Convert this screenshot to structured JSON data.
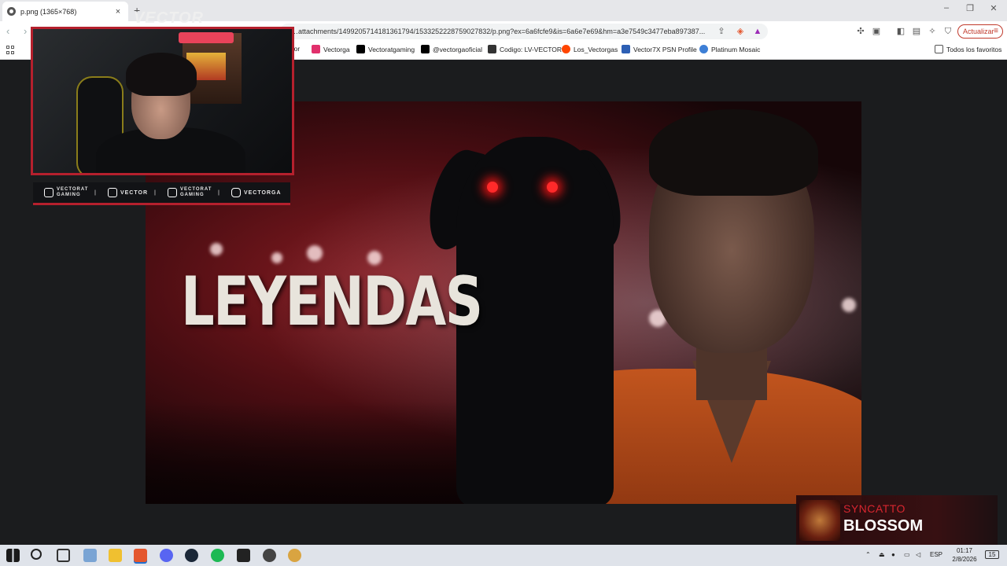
{
  "browser": {
    "tab_title": "p.png (1365×768)",
    "tab_close": "×",
    "new_tab": "+",
    "url": "…attachments/1499205714181361794/1533252228759027832/p.png?ex=6a6fcfe9&is=6a6e7e69&hm=a3e7549c3477eba897387...",
    "update_label": "Actualizar",
    "window_controls": [
      "–",
      "❐",
      "✕"
    ]
  },
  "bookmarks": {
    "items": [
      {
        "label": "ctor",
        "color": "#888888"
      },
      {
        "label": "Vectorga",
        "color": "#e1306c"
      },
      {
        "label": "Vectoratgaming",
        "color": "#000000"
      },
      {
        "label": "@vectorgaoficial",
        "color": "#000000"
      },
      {
        "label": "Codigo: LV-VECTOR",
        "color": "#333333"
      },
      {
        "label": "Los_Vectorgas",
        "color": "#ff4500"
      },
      {
        "label": "Vector7X PSN Profile",
        "color": "#2d5fb4"
      },
      {
        "label": "Platinum Mosaic",
        "color": "#3d7fd6"
      }
    ],
    "all_favorites": "Todos los favoritos"
  },
  "thumbnail": {
    "title": "LEYENDAS"
  },
  "webcam": {
    "logo": "VECTOR",
    "socials": [
      {
        "label": "VECTORAT GAMING",
        "icon": "youtube-icon"
      },
      {
        "label": "VECTOR",
        "icon": "twitch-icon"
      },
      {
        "label": "VECTORAT GAMING",
        "icon": "twitter-icon"
      },
      {
        "label": "VECTORGA",
        "icon": "instagram-icon"
      }
    ]
  },
  "now_playing": {
    "artist": "SYNCATTO",
    "track": "BLOSSOM"
  },
  "taskbar": {
    "language": "ESP",
    "time": "01:17",
    "date": "2/8/2026",
    "notifications": "15"
  },
  "colors": {
    "accent_red": "#b5202d",
    "update_red": "#c0392b",
    "shirt_orange": "#c2551e"
  }
}
